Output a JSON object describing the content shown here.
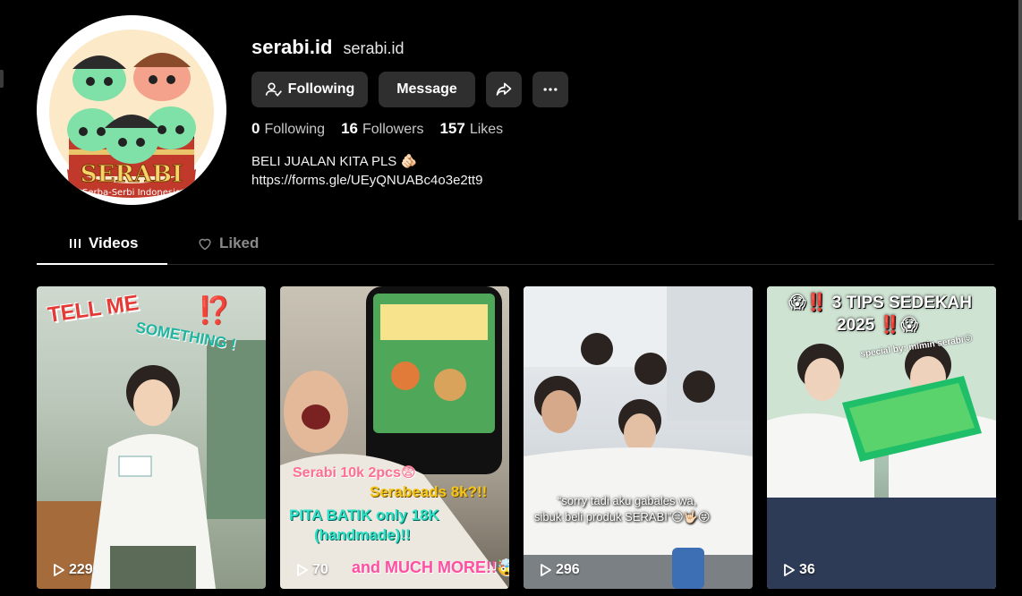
{
  "profile": {
    "title": "serabi.id",
    "subtitle": "serabi.id",
    "avatar_text": "SERABI",
    "avatar_subtext": "Serba-Serbi Indonesia"
  },
  "actions": {
    "following_label": "Following",
    "message_label": "Message",
    "share_icon": "share-icon",
    "more_icon": "more-icon"
  },
  "stats": [
    {
      "value": "0",
      "label": "Following"
    },
    {
      "value": "16",
      "label": "Followers"
    },
    {
      "value": "157",
      "label": "Likes"
    }
  ],
  "bio": {
    "line1": "BELI JUALAN KITA PLS 🫵🏻",
    "line2": "https://forms.gle/UEyQNUABc4o3e2tt9"
  },
  "tabs": [
    {
      "label": "Videos",
      "icon": "grid-icon",
      "active": true
    },
    {
      "label": "Liked",
      "icon": "heart-icon",
      "active": false
    }
  ],
  "videos": [
    {
      "views": "229",
      "overlay": [
        "TELL ME",
        "SOMETHING !",
        "⁉️"
      ]
    },
    {
      "views": "70",
      "overlay": [
        "Serabi 10k 2pcs😨",
        "Serabeads 8k?!!",
        "PITA BATIK only 18K",
        "(handmade)!!",
        "and MUCH MORE!!🤯"
      ]
    },
    {
      "views": "296",
      "overlay": [
        "“sorry tadi aku gabales wa,",
        "sibuk beli produk SERABI”😑🤟🏻😜"
      ]
    },
    {
      "views": "36",
      "overlay": [
        "😱‼️ 3 TIPS SEDEKAH",
        "2025 ‼️😱",
        "special by: mimin serabi😝"
      ]
    }
  ],
  "colors": {
    "background": "#000000",
    "button_bg": "#2f2f2f",
    "muted_text": "#c8c8c8",
    "inactive_tab": "#8a8a8a"
  }
}
